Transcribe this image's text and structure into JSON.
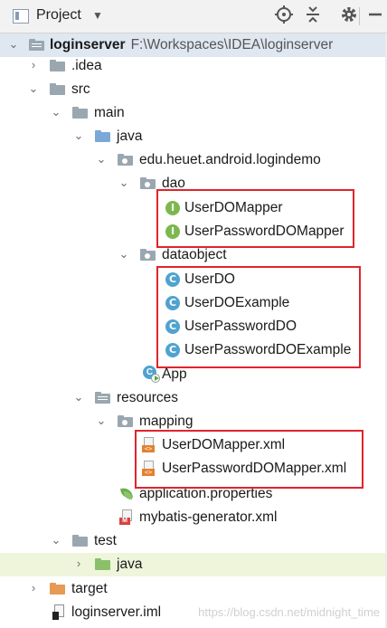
{
  "panel": {
    "title": "Project",
    "dropdown_icon": "chevron-down-icon",
    "actions": [
      "locate-icon",
      "collapse-all-icon",
      "gear-icon",
      "hide-icon"
    ]
  },
  "tree": {
    "root_name": "loginserver",
    "root_path": "F:\\Workspaces\\IDEA\\loginserver",
    "idea": ".idea",
    "src": "src",
    "main": "main",
    "java_main": "java",
    "package": "edu.heuet.android.logindemo",
    "dao": "dao",
    "user_do_mapper": "UserDOMapper",
    "user_password_do_mapper": "UserPasswordDOMapper",
    "dataobject": "dataobject",
    "user_do": "UserDO",
    "user_do_example": "UserDOExample",
    "user_password_do": "UserPasswordDO",
    "user_password_do_example": "UserPasswordDOExample",
    "app": "App",
    "resources": "resources",
    "mapping": "mapping",
    "user_do_mapper_xml": "UserDOMapper.xml",
    "user_password_do_mapper_xml": "UserPasswordDOMapper.xml",
    "application_properties": "application.properties",
    "mybatis_generator_xml": "mybatis-generator.xml",
    "test": "test",
    "java_test": "java",
    "target": "target",
    "iml": "loginserver.iml"
  },
  "icons": {
    "interface": "I",
    "class": "C",
    "xml_tag": "<>",
    "mybatis_badge": "M"
  },
  "watermark": "https://blog.csdn.net/midnight_time",
  "colors": {
    "highlight_box": "#e0242c",
    "selected_row": "#dfe7f1",
    "test_java_row": "#eef5db",
    "interface_icon": "#7cb84f",
    "class_icon": "#4fa3cf"
  }
}
